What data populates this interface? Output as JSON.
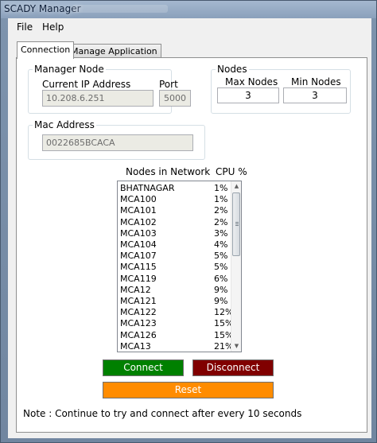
{
  "window": {
    "title": "SCADY Manager"
  },
  "menu": {
    "file": "File",
    "help": "Help"
  },
  "tabs": [
    {
      "label": "Connection"
    },
    {
      "label": "Manage Application"
    }
  ],
  "manager_node": {
    "legend": "Manager Node",
    "ip_label": "Current IP Address",
    "ip_value": "10.208.6.251",
    "port_label": "Port",
    "port_value": "5000"
  },
  "nodes": {
    "legend": "Nodes",
    "max_label": "Max Nodes",
    "max_value": "3",
    "min_label": "Min Nodes",
    "min_value": "3"
  },
  "mac": {
    "legend": "Mac Address",
    "value": "0022685BCACA"
  },
  "network": {
    "nodes_header": "Nodes in Network",
    "cpu_header": "CPU %",
    "items": [
      {
        "name": "BHATNAGAR",
        "cpu": "1%"
      },
      {
        "name": "MCA100",
        "cpu": "1%"
      },
      {
        "name": "MCA101",
        "cpu": "2%"
      },
      {
        "name": "MCA102",
        "cpu": "2%"
      },
      {
        "name": "MCA103",
        "cpu": "3%"
      },
      {
        "name": "MCA104",
        "cpu": "4%"
      },
      {
        "name": "MCA107",
        "cpu": "5%"
      },
      {
        "name": "MCA115",
        "cpu": "5%"
      },
      {
        "name": "MCA119",
        "cpu": "6%"
      },
      {
        "name": "MCA12",
        "cpu": "9%"
      },
      {
        "name": "MCA121",
        "cpu": "9%"
      },
      {
        "name": "MCA122",
        "cpu": "12%"
      },
      {
        "name": "MCA123",
        "cpu": "15%"
      },
      {
        "name": "MCA126",
        "cpu": "15%"
      },
      {
        "name": "MCA13",
        "cpu": "21%"
      }
    ]
  },
  "buttons": {
    "connect": "Connect",
    "disconnect": "Disconnect",
    "reset": "Reset"
  },
  "note": "Note : Continue to try and connect after every 10 seconds",
  "colors": {
    "connect": "#008000",
    "disconnect": "#800000",
    "reset": "#ff8c00"
  },
  "icons": {
    "scroll_up": "chevron-up-icon",
    "scroll_down": "chevron-down-icon"
  }
}
